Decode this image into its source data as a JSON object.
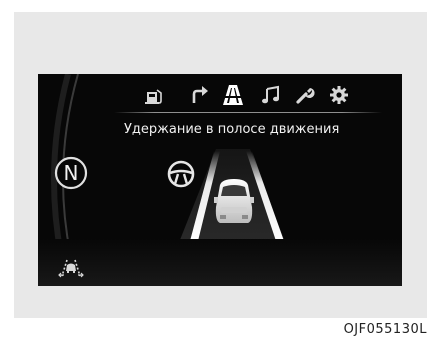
{
  "display": {
    "title": "Удержание в полосе движения",
    "gear": "N",
    "menu": [
      {
        "name": "trip-computer-icon"
      },
      {
        "name": "navigation-turn-icon"
      },
      {
        "name": "driving-assist-icon",
        "active": true
      },
      {
        "name": "audio-music-icon"
      },
      {
        "name": "maintenance-wrench-icon"
      },
      {
        "name": "settings-gear-icon"
      }
    ],
    "status_icons": [
      "steering-wheel-icon",
      "lane-assist-car-icon",
      "lane-departure-icon"
    ]
  },
  "caption": "OJF055130L",
  "colors": {
    "screen_bg": "#070707",
    "frame_bg": "#e8e8e8",
    "text": "#f2f2f2"
  }
}
